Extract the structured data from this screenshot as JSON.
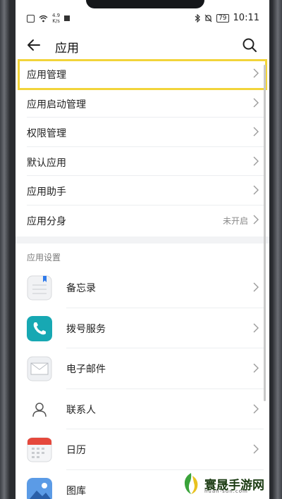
{
  "status_bar": {
    "net_speed_value": "4.9",
    "net_speed_unit": "K/s",
    "battery": "79",
    "time": "10:11"
  },
  "header": {
    "title": "应用",
    "back_icon": "back-arrow-icon",
    "search_icon": "search-icon"
  },
  "menu": [
    {
      "label": "应用管理",
      "value": ""
    },
    {
      "label": "应用启动管理",
      "value": ""
    },
    {
      "label": "权限管理",
      "value": ""
    },
    {
      "label": "默认应用",
      "value": ""
    },
    {
      "label": "应用助手",
      "value": ""
    },
    {
      "label": "应用分身",
      "value": "未开启"
    }
  ],
  "settings_section": {
    "heading": "应用设置",
    "items": [
      {
        "label": "备忘录",
        "icon": "notepad-icon"
      },
      {
        "label": "拨号服务",
        "icon": "phone-icon"
      },
      {
        "label": "电子邮件",
        "icon": "mail-icon"
      },
      {
        "label": "联系人",
        "icon": "contact-icon"
      },
      {
        "label": "日历",
        "icon": "calendar-icon"
      },
      {
        "label": "图库",
        "icon": "gallery-icon"
      }
    ]
  },
  "highlight_color": "#f2d43a",
  "watermark": {
    "text": "寰晟手游网",
    "url_text": "huan-sun.com"
  }
}
